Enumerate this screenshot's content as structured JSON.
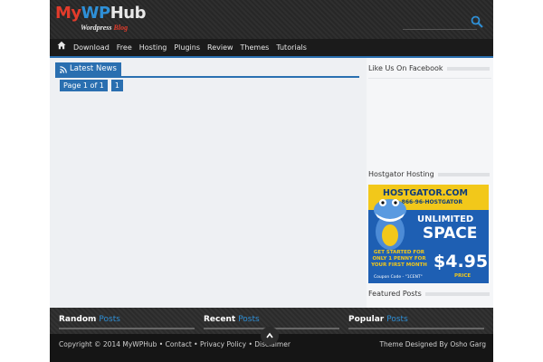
{
  "header": {
    "logo_text_a": "My",
    "logo_text_b": "WP",
    "logo_text_c": "Hub",
    "logo_sub_a": "Wordpress ",
    "logo_sub_b": "Blog",
    "icons": [
      "search-icon"
    ]
  },
  "nav": {
    "home_icon": "home-icon",
    "items": [
      "Download",
      "Free",
      "Hosting",
      "Plugins",
      "Review",
      "Themes",
      "Tutorials"
    ]
  },
  "main": {
    "tab_label": "Latest News",
    "tab_icon": "rss-icon",
    "pager_label": "Page 1 of 1",
    "pager_current": "1"
  },
  "sidebar": {
    "facebook_title": "Like Us On Facebook",
    "hosting_title": "Hostgator Hosting",
    "featured_title": "Featured Posts",
    "banner": {
      "brand": "HOSTGATOR.COM",
      "phone": "1-866-96-HOSTGATOR",
      "line1": "UNLIMITED",
      "line2": "SPACE",
      "cta": "GET STARTED FOR ONLY 1 PENNY FOR YOUR FIRST MONTH",
      "coupon": "Coupon Code - \"1CENT\"",
      "price": "$4.95",
      "price_label": "PRICE"
    }
  },
  "footer_widgets": [
    {
      "title": "Random",
      "accent": "Posts"
    },
    {
      "title": "Recent",
      "accent": "Posts"
    },
    {
      "title": "Popular",
      "accent": "Posts"
    }
  ],
  "bottom": {
    "copyright": "Copyright © 2014 MyWPHub • Contact • Privacy Policy • Disclaimer",
    "credit": "Theme Designed By Osho Garg"
  },
  "colors": {
    "accent": "#2a6fb0",
    "brand_red": "#e23b2b",
    "header_bg": "#2f2f2f"
  }
}
